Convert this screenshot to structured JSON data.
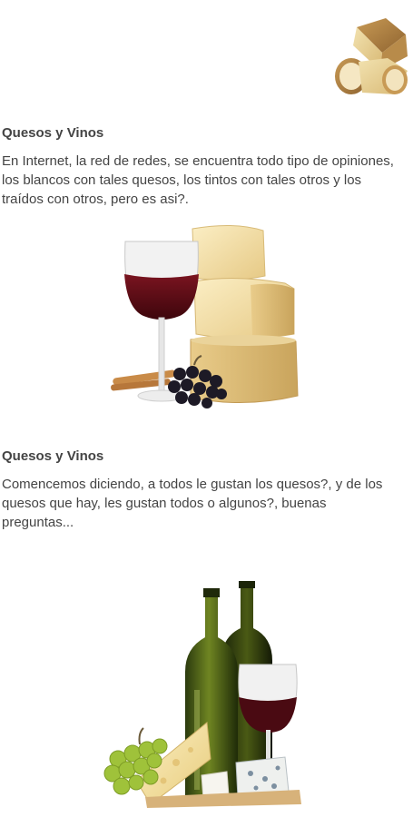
{
  "feed": {
    "items": [
      {
        "title": "Quesos y Vinos",
        "text": "En Internet, la red de redes, se encuentra todo tipo de opiniones, los blancos con tales quesos, los tintos con tales otros y los traídos con otros, pero es asi?."
      },
      {
        "title": "Quesos y Vinos",
        "text": "Comencemos diciendo, a todos le gustan los quesos?, y de los quesos que hay, les gustan todos o algunos?, buenas preguntas..."
      }
    ]
  },
  "images": {
    "top": "cheese-wedges-image",
    "first": "red-wine-glass-cheese-image",
    "second": "wine-bottles-cheese-grapes-image"
  }
}
